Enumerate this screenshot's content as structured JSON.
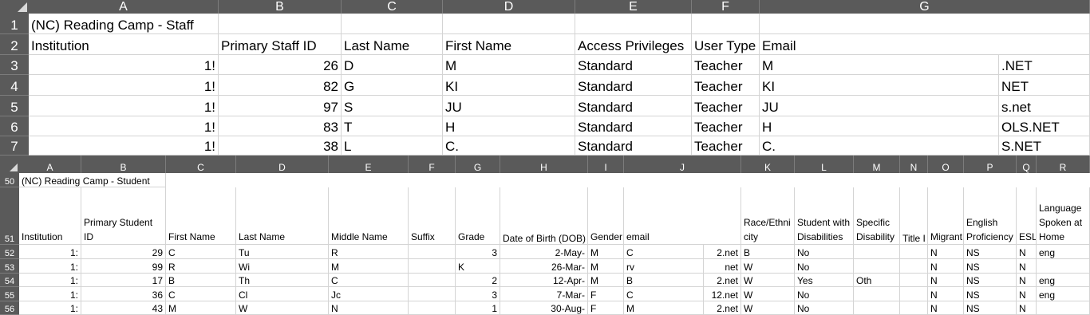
{
  "top": {
    "columns": [
      "A",
      "B",
      "C",
      "D",
      "E",
      "F",
      "G"
    ],
    "rows": [
      "1",
      "2",
      "3",
      "4",
      "5",
      "6",
      "7"
    ],
    "title": "(NC) Reading Camp - Staff",
    "headers": {
      "institution": "Institution",
      "staff_id": "Primary Staff ID",
      "last_name": "Last Name",
      "first_name": "First Name",
      "access": "Access Privileges",
      "user_type": "User Type",
      "email": "Email"
    },
    "data": [
      {
        "inst": "1!",
        "id": "26",
        "last": "D",
        "first": "M",
        "access": "Standard",
        "type": "Teacher",
        "email": "M",
        "email_end": ".NET"
      },
      {
        "inst": "1!",
        "id": "82",
        "last": "G",
        "first": "KI",
        "access": "Standard",
        "type": "Teacher",
        "email": "KI",
        "email_end": "NET"
      },
      {
        "inst": "1!",
        "id": "97",
        "last": "S",
        "first": "JU",
        "access": "Standard",
        "type": "Teacher",
        "email": "JU",
        "email_end": "s.net"
      },
      {
        "inst": "1!",
        "id": "83",
        "last": "T",
        "first": "H",
        "access": "Standard",
        "type": "Teacher",
        "email": "H",
        "email_end": "OLS.NET"
      },
      {
        "inst": "1!",
        "id": "38",
        "last": "L",
        "first": "C.",
        "access": "Standard",
        "type": "Teacher",
        "email": "C.",
        "email_end": "S.NET"
      }
    ]
  },
  "bottom": {
    "columns": [
      "A",
      "B",
      "C",
      "D",
      "E",
      "F",
      "G",
      "H",
      "I",
      "J",
      "K",
      "L",
      "M",
      "N",
      "O",
      "P",
      "Q",
      "R"
    ],
    "rows": [
      "50",
      "51",
      "52",
      "53",
      "54",
      "55",
      "56"
    ],
    "title": "(NC) Reading Camp - Student",
    "headers": {
      "institution": "Institution",
      "student_id": "Primary Student ID",
      "first_name": "First Name",
      "last_name": "Last Name",
      "middle_name": "Middle Name",
      "suffix": "Suffix",
      "grade": "Grade",
      "dob": "Date of Birth (DOB)",
      "gender": "Gender",
      "email": "email",
      "race": "Race/Ethnicity",
      "swd": "Student with Disabilities",
      "specific": "Specific Disability",
      "title1": "Title I",
      "migrant": "Migrant",
      "elp": "English Proficiency",
      "esl": "ESL",
      "lang": "Language Spoken at Home"
    },
    "data": [
      {
        "inst": "1:",
        "id": "29",
        "first": "C",
        "last": "Tu",
        "middle": "R",
        "grade": "3",
        "dob": "2-May-",
        "gender": "M",
        "email": "C",
        "email_end": "2.net",
        "race": "B",
        "swd": "No",
        "specific": "",
        "migrant": "N",
        "elp": "NS",
        "esl": "N",
        "lang": "eng"
      },
      {
        "inst": "1:",
        "id": "99",
        "first": "R",
        "last": "Wi",
        "middle": "M",
        "grade": "K",
        "dob": "26-Mar-",
        "gender": "M",
        "email": "rv",
        "email_end": "net",
        "race": "W",
        "swd": "No",
        "specific": "",
        "migrant": "N",
        "elp": "NS",
        "esl": "N",
        "lang": ""
      },
      {
        "inst": "1:",
        "id": "17",
        "first": "B",
        "last": "Th",
        "middle": "C",
        "grade": "2",
        "dob": "12-Apr-",
        "gender": "M",
        "email": "B",
        "email_end": "2.net",
        "race": "W",
        "swd": "Yes",
        "specific": "Oth",
        "migrant": "N",
        "elp": "NS",
        "esl": "N",
        "lang": "eng"
      },
      {
        "inst": "1:",
        "id": "36",
        "first": "C",
        "last": "Cl",
        "middle": "Jc",
        "grade": "3",
        "dob": "7-Mar-",
        "gender": "F",
        "email": "C",
        "email_end": "12.net",
        "race": "W",
        "swd": "No",
        "specific": "",
        "migrant": "N",
        "elp": "NS",
        "esl": "N",
        "lang": "eng"
      },
      {
        "inst": "1:",
        "id": "43",
        "first": "M",
        "last": "W",
        "middle": "N",
        "grade": "1",
        "dob": "30-Aug-",
        "gender": "F",
        "email": "M",
        "email_end": "2.net",
        "race": "W",
        "swd": "No",
        "specific": "",
        "migrant": "N",
        "elp": "NS",
        "esl": "N",
        "lang": ""
      }
    ]
  }
}
